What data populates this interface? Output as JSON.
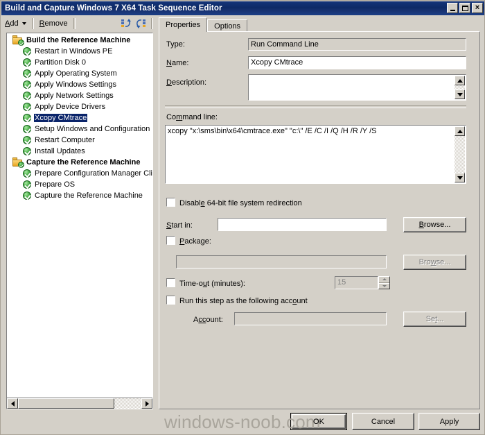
{
  "window": {
    "title": "Build and Capture Windows 7 X64 Task Sequence Editor",
    "minimize_label": "_",
    "maximize_label": "",
    "close_label": "×"
  },
  "toolbar": {
    "add_label": "Add",
    "remove_label": "Remove",
    "icon_move_up": "move-up-icon",
    "icon_move_down": "move-down-icon"
  },
  "tabs": [
    {
      "label": "Properties",
      "active": true
    },
    {
      "label": "Options",
      "active": false
    }
  ],
  "tree": {
    "nodes": [
      {
        "label": "Build the Reference Machine",
        "type": "group",
        "selected": false
      },
      {
        "label": "Restart in Windows PE",
        "type": "child",
        "selected": false
      },
      {
        "label": "Partition Disk 0",
        "type": "child",
        "selected": false
      },
      {
        "label": "Apply Operating System",
        "type": "child",
        "selected": false
      },
      {
        "label": "Apply Windows Settings",
        "type": "child",
        "selected": false
      },
      {
        "label": "Apply Network Settings",
        "type": "child",
        "selected": false
      },
      {
        "label": "Apply Device Drivers",
        "type": "child",
        "selected": false
      },
      {
        "label": "Xcopy CMtrace",
        "type": "child",
        "selected": true
      },
      {
        "label": "Setup Windows and Configuration",
        "type": "child",
        "selected": false
      },
      {
        "label": "Restart Computer",
        "type": "child",
        "selected": false
      },
      {
        "label": "Install Updates",
        "type": "child",
        "selected": false
      },
      {
        "label": "Capture the Reference Machine",
        "type": "group",
        "selected": false
      },
      {
        "label": "Prepare Configuration Manager Cli",
        "type": "child",
        "selected": false
      },
      {
        "label": "Prepare OS",
        "type": "child",
        "selected": false
      },
      {
        "label": "Capture the Reference Machine",
        "type": "child",
        "selected": false
      }
    ],
    "scroll_left_icon": "scroll-left-arrow-icon",
    "scroll_right_icon": "scroll-right-arrow-icon"
  },
  "properties": {
    "type_label": "Type:",
    "type_value": "Run Command Line",
    "name_label": "Name:",
    "name_value": "Xcopy CMtrace",
    "name_placeholder": "",
    "description_label": "Description:",
    "description_value": "",
    "description_placeholder": "",
    "command_line_label": "Command line:",
    "command_line_value": "xcopy \"x:\\sms\\bin\\x64\\cmtrace.exe\" \"c:\\\" /E /C /I /Q /H /R /Y /S",
    "disable_redirection_label": "Disable 64-bit file system redirection",
    "disable_redirection_checked": false,
    "start_in_label": "Start in:",
    "start_in_value": "",
    "start_in_browse_label": "Browse...",
    "package_label": "Package:",
    "package_checked": false,
    "package_value": "",
    "package_browse_label": "Browse...",
    "timeout_label": "Time-out (minutes):",
    "timeout_checked": false,
    "timeout_value": "15",
    "run_as_account_label": "Run this step as the following account",
    "run_as_account_checked": false,
    "account_label": "Account:",
    "account_value": "",
    "account_set_label": "Set..."
  },
  "footer": {
    "ok_label": "OK",
    "cancel_label": "Cancel",
    "apply_label": "Apply",
    "watermark": "windows-noob.com"
  }
}
